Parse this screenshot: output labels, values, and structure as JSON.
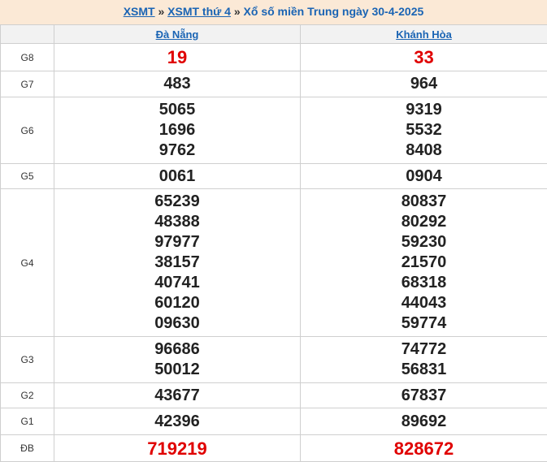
{
  "breadcrumb": {
    "link1": "XSMT",
    "sep1": "»",
    "link2": "XSMT thứ 4",
    "sep2": "»",
    "title": "Xổ số miền Trung ngày 30-4-2025"
  },
  "provinces": [
    "Đà Nẵng",
    "Khánh Hòa"
  ],
  "rows": [
    {
      "prize": "G8",
      "cols": [
        [
          "19"
        ],
        [
          "33"
        ]
      ]
    },
    {
      "prize": "G7",
      "cols": [
        [
          "483"
        ],
        [
          "964"
        ]
      ]
    },
    {
      "prize": "G6",
      "cols": [
        [
          "5065",
          "1696",
          "9762"
        ],
        [
          "9319",
          "5532",
          "8408"
        ]
      ]
    },
    {
      "prize": "G5",
      "cols": [
        [
          "0061"
        ],
        [
          "0904"
        ]
      ]
    },
    {
      "prize": "G4",
      "cols": [
        [
          "65239",
          "48388",
          "97977",
          "38157",
          "40741",
          "60120",
          "09630"
        ],
        [
          "80837",
          "80292",
          "59230",
          "21570",
          "68318",
          "44043",
          "59774"
        ]
      ]
    },
    {
      "prize": "G3",
      "cols": [
        [
          "96686",
          "50012"
        ],
        [
          "74772",
          "56831"
        ]
      ]
    },
    {
      "prize": "G2",
      "cols": [
        [
          "43677"
        ],
        [
          "67837"
        ]
      ]
    },
    {
      "prize": "G1",
      "cols": [
        [
          "42396"
        ],
        [
          "89692"
        ]
      ]
    },
    {
      "prize": "ĐB",
      "cols": [
        [
          "719219"
        ],
        [
          "828672"
        ]
      ]
    }
  ],
  "colors": {
    "header_bg": "#fbe9d6",
    "link": "#1a64b4",
    "highlight": "#e00000"
  }
}
